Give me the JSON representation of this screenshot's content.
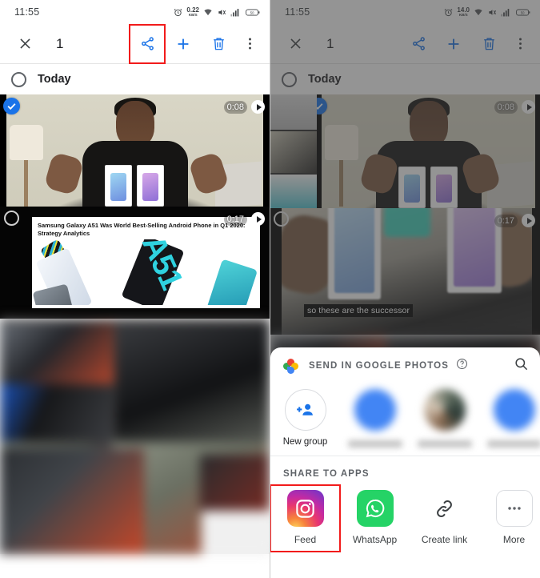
{
  "left_panel": {
    "statusbar": {
      "time": "11:55",
      "net_speed_value": "0.22",
      "net_speed_unit": "KB/S",
      "icons": [
        "alarm-icon",
        "network-speed",
        "wifi-icon",
        "mute-icon",
        "signal-icon",
        "battery-icon"
      ],
      "battery_level": "50"
    },
    "actionbar": {
      "close_label": "✕",
      "selected_count": "1",
      "share_label": "share-icon",
      "add_label": "add-icon",
      "delete_label": "delete-icon",
      "more_label": "more-icon",
      "highlight_color": "#f21b1b",
      "accent_color": "#1a73e8"
    },
    "day_header": {
      "label": "Today"
    },
    "media": [
      {
        "duration": "0:08",
        "selected": true,
        "caption": ""
      },
      {
        "duration": "0:17",
        "selected": false,
        "headline": "Samsung Galaxy A51 Was World Best-Selling Android Phone in Q1 2020: Strategy Analytics",
        "phone_label": "A51"
      }
    ]
  },
  "right_panel": {
    "statusbar": {
      "time": "11:55",
      "net_speed_value": "14.0",
      "net_speed_unit": "KB/S",
      "battery_level": "50"
    },
    "actionbar": {
      "close_label": "✕",
      "selected_count": "1"
    },
    "day_header": {
      "label": "Today"
    },
    "media": [
      {
        "duration": "0:08",
        "selected": true
      },
      {
        "duration": "0:17",
        "selected": false,
        "caption": "so these are the successor"
      }
    ],
    "share_sheet": {
      "title": "SEND IN GOOGLE PHOTOS",
      "help_icon": "help-icon",
      "search_icon": "search-icon",
      "contacts": [
        {
          "name": "New group",
          "avatar": "add-group-icon",
          "redacted": false
        },
        {
          "name": "",
          "avatar": "person-avatar",
          "redacted": true
        },
        {
          "name": "",
          "avatar": "photo-avatar",
          "redacted": true
        },
        {
          "name": "",
          "avatar": "person-avatar",
          "redacted": true
        }
      ],
      "apps_label": "SHARE TO APPS",
      "apps": [
        {
          "name": "Feed",
          "icon": "instagram-icon",
          "highlighted": true
        },
        {
          "name": "WhatsApp",
          "icon": "whatsapp-icon",
          "highlighted": false
        },
        {
          "name": "Create link",
          "icon": "link-icon",
          "highlighted": false
        },
        {
          "name": "More",
          "icon": "more-icon",
          "highlighted": false
        }
      ]
    }
  }
}
